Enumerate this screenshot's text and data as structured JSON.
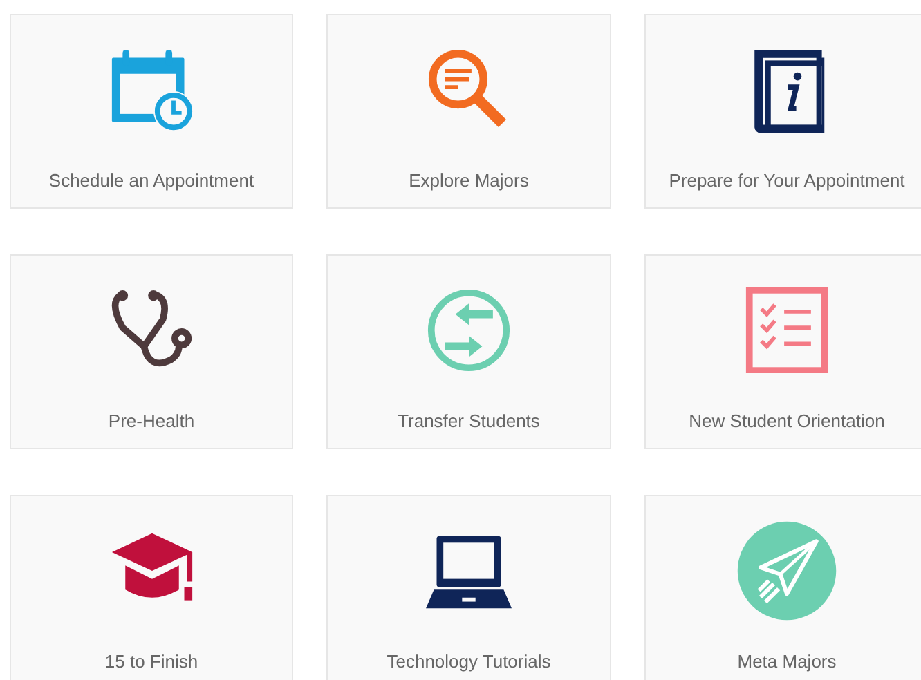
{
  "tiles": [
    {
      "label": "Schedule an Appointment",
      "kind": "calendar"
    },
    {
      "label": "Explore Majors",
      "kind": "search"
    },
    {
      "label": "Prepare for Your Appointment",
      "kind": "book"
    },
    {
      "label": "Pre-Health",
      "kind": "stethoscope"
    },
    {
      "label": "Transfer Students",
      "kind": "transfer"
    },
    {
      "label": "New Student Orientation",
      "kind": "checklist"
    },
    {
      "label": "15 to Finish",
      "kind": "cap"
    },
    {
      "label": "Technology Tutorials",
      "kind": "laptop"
    },
    {
      "label": "Meta Majors",
      "kind": "plane"
    }
  ]
}
